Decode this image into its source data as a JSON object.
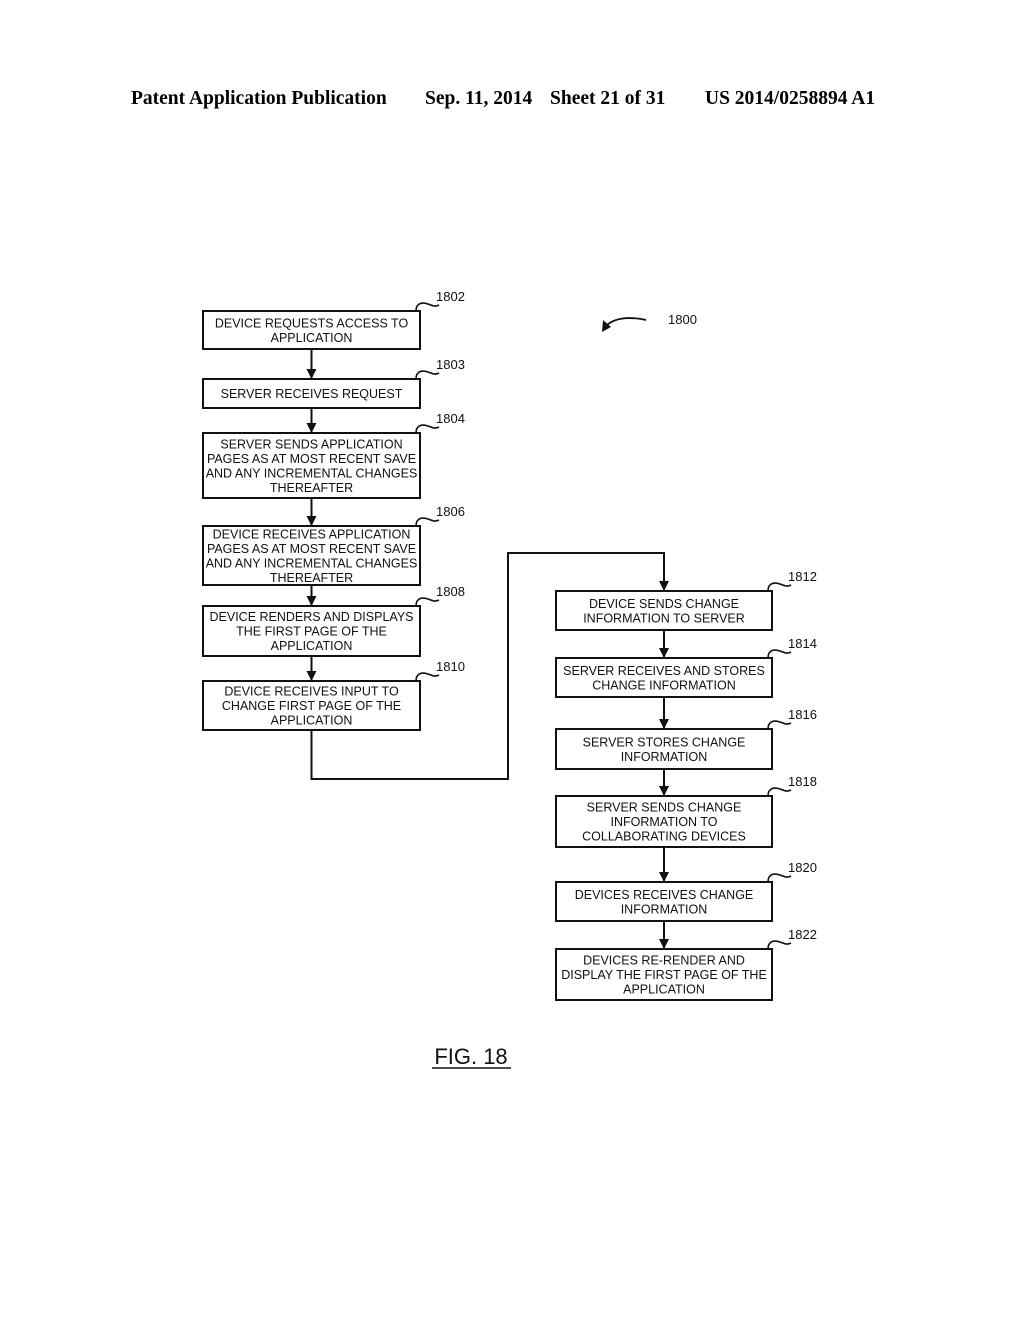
{
  "header": {
    "publication": "Patent Application Publication",
    "date": "Sep. 11, 2014",
    "sheet": "Sheet 21 of 31",
    "number": "US 2014/0258894 A1"
  },
  "figure": {
    "label": "FIG. 18",
    "ref": "1800"
  },
  "steps": [
    {
      "ref": "1802",
      "lines": [
        "DEVICE REQUESTS ACCESS TO",
        "APPLICATION"
      ]
    },
    {
      "ref": "1803",
      "lines": [
        "SERVER RECEIVES REQUEST"
      ]
    },
    {
      "ref": "1804",
      "lines": [
        "SERVER SENDS APPLICATION",
        "PAGES AS AT MOST RECENT SAVE",
        "AND ANY INCREMENTAL CHANGES",
        "THEREAFTER"
      ]
    },
    {
      "ref": "1806",
      "lines": [
        "DEVICE RECEIVES APPLICATION",
        "PAGES AS AT MOST RECENT SAVE",
        "AND ANY INCREMENTAL CHANGES",
        "THEREAFTER"
      ]
    },
    {
      "ref": "1808",
      "lines": [
        "DEVICE RENDERS AND DISPLAYS",
        "THE FIRST PAGE OF THE",
        "APPLICATION"
      ]
    },
    {
      "ref": "1810",
      "lines": [
        "DEVICE RECEIVES INPUT TO",
        "CHANGE FIRST PAGE OF THE",
        "APPLICATION"
      ]
    },
    {
      "ref": "1812",
      "lines": [
        "DEVICE SENDS CHANGE",
        "INFORMATION TO SERVER"
      ]
    },
    {
      "ref": "1814",
      "lines": [
        "SERVER RECEIVES AND STORES",
        "CHANGE INFORMATION"
      ]
    },
    {
      "ref": "1816",
      "lines": [
        "SERVER STORES CHANGE",
        "INFORMATION"
      ]
    },
    {
      "ref": "1818",
      "lines": [
        "SERVER SENDS CHANGE",
        "INFORMATION TO",
        "COLLABORATING DEVICES"
      ]
    },
    {
      "ref": "1820",
      "lines": [
        "DEVICES RECEIVES CHANGE",
        "INFORMATION"
      ]
    },
    {
      "ref": "1822",
      "lines": [
        "DEVICES RE-RENDER AND",
        "DISPLAY THE FIRST PAGE OF THE",
        "APPLICATION"
      ]
    }
  ]
}
